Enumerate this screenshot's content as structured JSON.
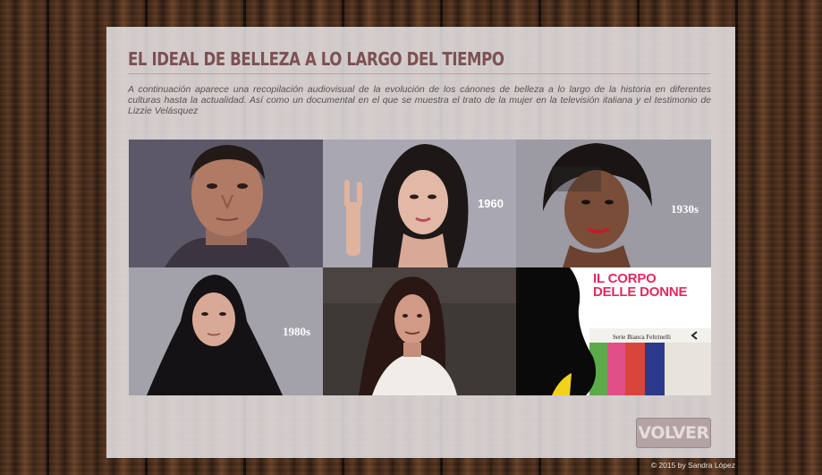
{
  "page": {
    "title": "EL IDEAL DE BELLEZA A LO LARGO DEL TIEMPO",
    "intro": "A continuación aparece una recopilación audiovisual de la evolución de los cánones de belleza a lo largo de la historia en diferentes culturas hasta la actualidad.  Así como un documental en el que se muestra el trato de la mujer en la televisión italiana y el testimonio de Lizzie Velásquez"
  },
  "gallery": {
    "items": [
      {
        "name": "man-portrait",
        "label": ""
      },
      {
        "name": "woman-1960",
        "label": "1960"
      },
      {
        "name": "woman-1930s",
        "label": "1930s"
      },
      {
        "name": "woman-1980s",
        "label": "1980s"
      },
      {
        "name": "lizzie-velasquez",
        "label": ""
      },
      {
        "name": "il-corpo-delle-donne",
        "label": ""
      }
    ],
    "book": {
      "title_line1": "IL CORPO",
      "title_line2": "DELLE DONNE",
      "series": "Serie Bianca Feltrinelli"
    }
  },
  "actions": {
    "back_label": "VOLVER"
  },
  "footer": {
    "credit": "© 2015 by Sandra López"
  },
  "colors": {
    "title": "#7d5154",
    "button": "#b3a3a4",
    "book_title": "#e02a5f",
    "panel": "#eceaec"
  }
}
